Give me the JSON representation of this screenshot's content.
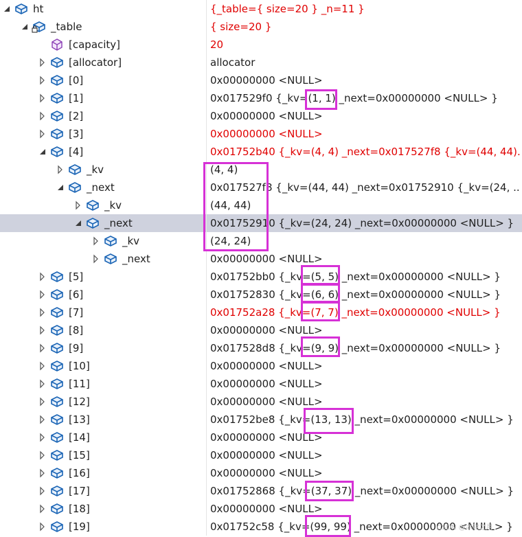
{
  "colors": {
    "changed_value": "#e00000",
    "highlight_box": "#d631d6",
    "selected_row": "#cfd2de"
  },
  "watermark": "CSDN @冰封之月",
  "rows": [
    {
      "name": "ht",
      "value": "{_table={ size=20 } _n=11 }",
      "depth": 0,
      "arrow": "expanded",
      "icon": "object-icon",
      "changed": true
    },
    {
      "name": "_table",
      "value": "{ size=20 }",
      "depth": 1,
      "arrow": "expanded",
      "icon": "locked-object-icon",
      "changed": true
    },
    {
      "name": "[capacity]",
      "value": "20",
      "depth": 2,
      "arrow": "none",
      "icon": "property-icon",
      "changed": true
    },
    {
      "name": "[allocator]",
      "value": "allocator",
      "depth": 2,
      "arrow": "collapsed",
      "icon": "object-icon",
      "changed": false
    },
    {
      "name": "[0]",
      "value": "0x00000000 <NULL>",
      "depth": 2,
      "arrow": "collapsed",
      "icon": "object-icon",
      "changed": false
    },
    {
      "name": "[1]",
      "value": "0x017529f0 {_kv=(1, 1) _next=0x00000000 <NULL> }",
      "depth": 2,
      "arrow": "collapsed",
      "icon": "object-icon",
      "changed": false
    },
    {
      "name": "[2]",
      "value": "0x00000000 <NULL>",
      "depth": 2,
      "arrow": "collapsed",
      "icon": "object-icon",
      "changed": false
    },
    {
      "name": "[3]",
      "value": "0x00000000 <NULL>",
      "depth": 2,
      "arrow": "collapsed",
      "icon": "object-icon",
      "changed": true
    },
    {
      "name": "[4]",
      "value": "0x01752b40 {_kv=(4, 4) _next=0x017527f8 {_kv=(44, 44)...",
      "depth": 2,
      "arrow": "expanded",
      "icon": "object-icon",
      "changed": true
    },
    {
      "name": "_kv",
      "value": "(4, 4)",
      "depth": 3,
      "arrow": "collapsed",
      "icon": "object-icon",
      "changed": false
    },
    {
      "name": "_next",
      "value": "0x017527f8 {_kv=(44, 44) _next=0x01752910 {_kv=(24, ...",
      "depth": 3,
      "arrow": "expanded",
      "icon": "object-icon",
      "changed": false
    },
    {
      "name": "_kv",
      "value": "(44, 44)",
      "depth": 4,
      "arrow": "collapsed",
      "icon": "object-icon",
      "changed": false
    },
    {
      "name": "_next",
      "value": "0x01752910 {_kv=(24, 24) _next=0x00000000 <NULL> }",
      "depth": 4,
      "arrow": "expanded",
      "icon": "object-icon",
      "changed": false,
      "selected": true
    },
    {
      "name": "_kv",
      "value": "(24, 24)",
      "depth": 5,
      "arrow": "collapsed",
      "icon": "object-icon",
      "changed": false
    },
    {
      "name": "_next",
      "value": "0x00000000 <NULL>",
      "depth": 5,
      "arrow": "collapsed",
      "icon": "object-icon",
      "changed": false
    },
    {
      "name": "[5]",
      "value": "0x01752bb0 {_kv=(5, 5) _next=0x00000000 <NULL> }",
      "depth": 2,
      "arrow": "collapsed",
      "icon": "object-icon",
      "changed": false
    },
    {
      "name": "[6]",
      "value": "0x01752830 {_kv=(6, 6) _next=0x00000000 <NULL> }",
      "depth": 2,
      "arrow": "collapsed",
      "icon": "object-icon",
      "changed": false
    },
    {
      "name": "[7]",
      "value": "0x01752a28 {_kv=(7, 7) _next=0x00000000 <NULL> }",
      "depth": 2,
      "arrow": "collapsed",
      "icon": "object-icon",
      "changed": true
    },
    {
      "name": "[8]",
      "value": "0x00000000 <NULL>",
      "depth": 2,
      "arrow": "collapsed",
      "icon": "object-icon",
      "changed": false
    },
    {
      "name": "[9]",
      "value": "0x017528d8 {_kv=(9, 9) _next=0x00000000 <NULL> }",
      "depth": 2,
      "arrow": "collapsed",
      "icon": "object-icon",
      "changed": false
    },
    {
      "name": "[10]",
      "value": "0x00000000 <NULL>",
      "depth": 2,
      "arrow": "collapsed",
      "icon": "object-icon",
      "changed": false
    },
    {
      "name": "[11]",
      "value": "0x00000000 <NULL>",
      "depth": 2,
      "arrow": "collapsed",
      "icon": "object-icon",
      "changed": false
    },
    {
      "name": "[12]",
      "value": "0x00000000 <NULL>",
      "depth": 2,
      "arrow": "collapsed",
      "icon": "object-icon",
      "changed": false
    },
    {
      "name": "[13]",
      "value": "0x01752be8 {_kv=(13, 13) _next=0x00000000 <NULL> }",
      "depth": 2,
      "arrow": "collapsed",
      "icon": "object-icon",
      "changed": false
    },
    {
      "name": "[14]",
      "value": "0x00000000 <NULL>",
      "depth": 2,
      "arrow": "collapsed",
      "icon": "object-icon",
      "changed": false
    },
    {
      "name": "[15]",
      "value": "0x00000000 <NULL>",
      "depth": 2,
      "arrow": "collapsed",
      "icon": "object-icon",
      "changed": false
    },
    {
      "name": "[16]",
      "value": "0x00000000 <NULL>",
      "depth": 2,
      "arrow": "collapsed",
      "icon": "object-icon",
      "changed": false
    },
    {
      "name": "[17]",
      "value": "0x01752868 {_kv=(37, 37) _next=0x00000000 <NULL> }",
      "depth": 2,
      "arrow": "collapsed",
      "icon": "object-icon",
      "changed": false
    },
    {
      "name": "[18]",
      "value": "0x00000000 <NULL>",
      "depth": 2,
      "arrow": "collapsed",
      "icon": "object-icon",
      "changed": false
    },
    {
      "name": "[19]",
      "value": "0x01752c58 {_kv=(99, 99) _next=0x00000000 <NULL> }",
      "depth": 2,
      "arrow": "collapsed",
      "icon": "object-icon",
      "changed": false
    }
  ]
}
